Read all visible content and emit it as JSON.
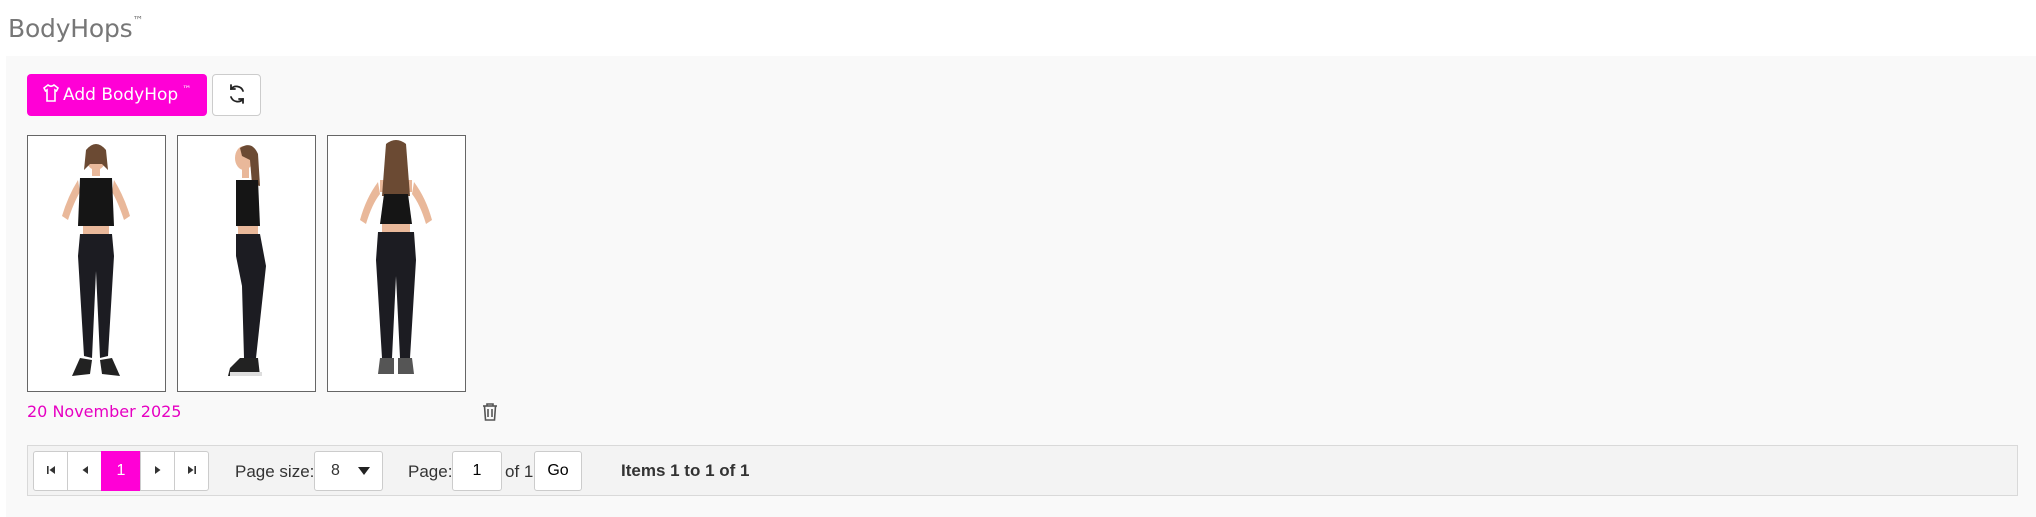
{
  "header": {
    "title": "BodyHops",
    "title_mark": "™"
  },
  "toolbar": {
    "add_label": "Add BodyHop",
    "add_mark": "™",
    "add_icon": "shirt-icon",
    "refresh_icon": "refresh-icon"
  },
  "entry": {
    "images": [
      "front view",
      "side view",
      "back view"
    ],
    "date": "20 November 2025",
    "delete_icon": "trash-icon"
  },
  "pager": {
    "current_page": "1",
    "page_size_label": "Page size:",
    "page_size_value": "8",
    "page_label": "Page:",
    "page_input_value": "1",
    "of_label": "of 1",
    "go_label": "Go",
    "items_info": "Items 1 to 1 of 1"
  },
  "colors": {
    "accent": "#ff00d6",
    "link": "#e600c2"
  }
}
